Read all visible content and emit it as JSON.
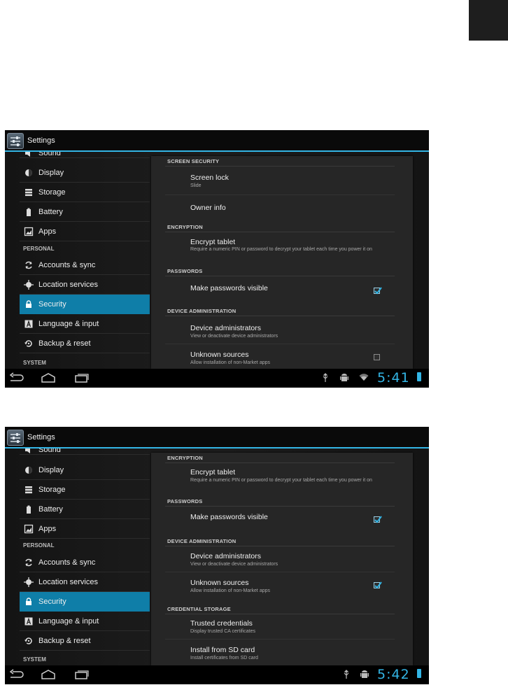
{
  "screens": [
    {
      "app_title": "Settings",
      "nav": {
        "clipped_item": "Sound",
        "items": [
          "Display",
          "Storage",
          "Battery",
          "Apps"
        ],
        "personal_header": "PERSONAL",
        "personal_items": [
          "Accounts & sync",
          "Location services",
          "Security",
          "Language & input",
          "Backup & reset"
        ],
        "system_header": "SYSTEM",
        "selected": "Security"
      },
      "sections": {
        "screen_security": "SCREEN SECURITY",
        "encryption": "ENCRYPTION",
        "passwords": "PASSWORDS",
        "device_admin": "DEVICE ADMINISTRATION"
      },
      "prefs": {
        "screen_lock": {
          "title": "Screen lock",
          "summary": "Slide"
        },
        "owner_info": {
          "title": "Owner info"
        },
        "encrypt": {
          "title": "Encrypt tablet",
          "summary": "Require a numeric PIN or password to decrypt your tablet each time you power it on"
        },
        "make_visible": {
          "title": "Make passwords visible",
          "checked": true
        },
        "device_admins": {
          "title": "Device administrators",
          "summary": "View or deactivate device administrators"
        },
        "unknown_sources": {
          "title": "Unknown sources",
          "summary": "Allow installation of non-Market apps",
          "checked": false
        }
      },
      "clock": "5:41"
    },
    {
      "app_title": "Settings",
      "nav": {
        "clipped_item": "Sound",
        "items": [
          "Display",
          "Storage",
          "Battery",
          "Apps"
        ],
        "personal_header": "PERSONAL",
        "personal_items": [
          "Accounts & sync",
          "Location services",
          "Security",
          "Language & input",
          "Backup & reset"
        ],
        "system_header": "SYSTEM",
        "selected": "Security"
      },
      "sections": {
        "encryption": "ENCRYPTION",
        "passwords": "PASSWORDS",
        "device_admin": "DEVICE ADMINISTRATION",
        "credential_storage": "CREDENTIAL STORAGE"
      },
      "prefs": {
        "encrypt": {
          "title": "Encrypt tablet",
          "summary": "Require a numeric PIN or password to decrypt your tablet each time you power it on"
        },
        "make_visible": {
          "title": "Make passwords visible",
          "checked": true
        },
        "device_admins": {
          "title": "Device administrators",
          "summary": "View or deactivate device administrators"
        },
        "unknown_sources": {
          "title": "Unknown sources",
          "summary": "Allow installation of non-Market apps",
          "checked": true
        },
        "trusted_credentials": {
          "title": "Trusted credentials",
          "summary": "Display trusted CA certificates"
        },
        "install_sd": {
          "title": "Install from SD card",
          "summary": "Install certificates from SD card"
        }
      },
      "clock": "5:42"
    }
  ],
  "icons": {
    "sound": "speaker-icon",
    "display": "brightness-icon",
    "storage": "storage-icon",
    "battery": "battery-icon",
    "apps": "apps-icon",
    "accounts": "sync-icon",
    "location": "location-icon",
    "security": "lock-icon",
    "language": "keyboard-icon",
    "backup": "backup-icon",
    "back": "back-icon",
    "home": "home-icon",
    "recents": "recent-apps-icon"
  },
  "colors": {
    "accent": "#33b5e5",
    "selected": "#0f7ea8",
    "background": "#121212"
  }
}
